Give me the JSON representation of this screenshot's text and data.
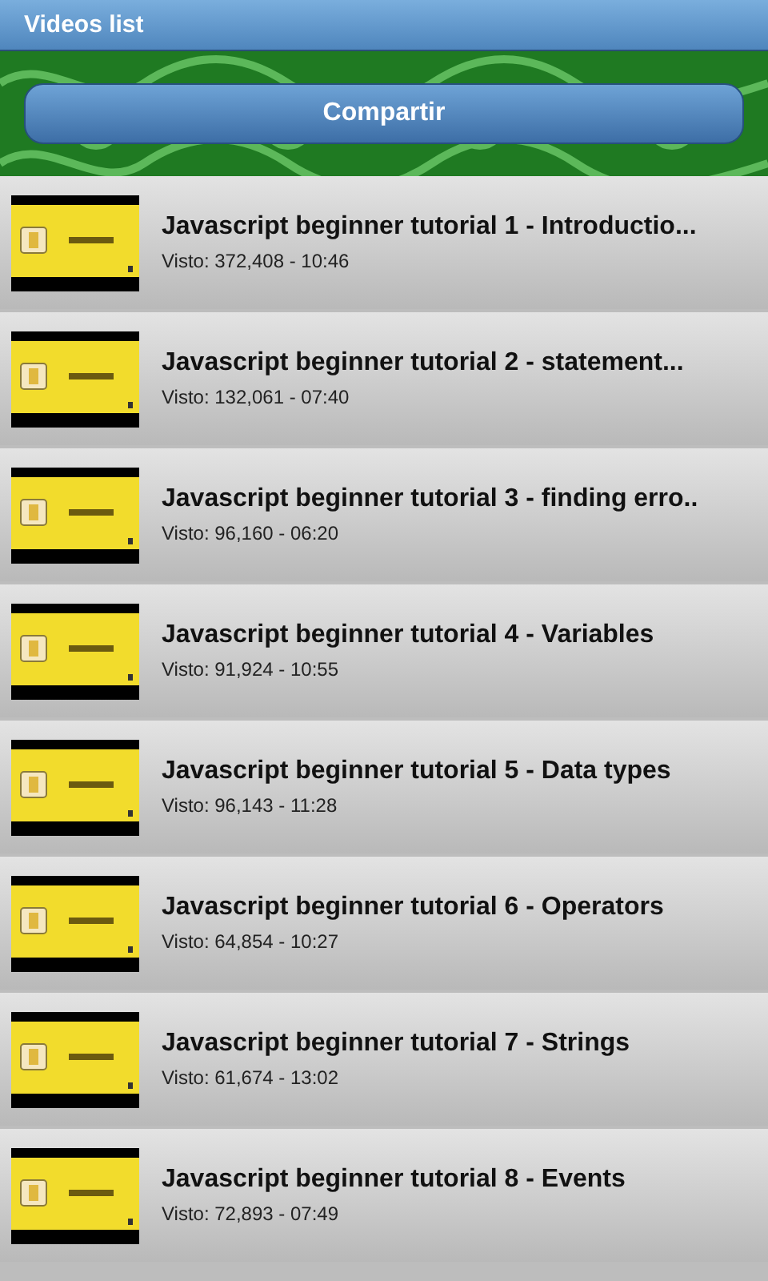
{
  "title_bar": {
    "title": "Videos list"
  },
  "share_button": {
    "label": "Compartir"
  },
  "videos": [
    {
      "title": "Javascript beginner tutorial 1 - Introductio...",
      "views": "Visto: 372,408 - 10:46"
    },
    {
      "title": "Javascript beginner tutorial 2 - statement...",
      "views": "Visto: 132,061 - 07:40"
    },
    {
      "title": "Javascript beginner tutorial 3 - finding erro..",
      "views": "Visto: 96,160 - 06:20"
    },
    {
      "title": "Javascript beginner tutorial 4 - Variables",
      "views": "Visto: 91,924 - 10:55"
    },
    {
      "title": "Javascript beginner tutorial 5 - Data types",
      "views": "Visto: 96,143 - 11:28"
    },
    {
      "title": "Javascript beginner tutorial 6 - Operators",
      "views": "Visto: 64,854 - 10:27"
    },
    {
      "title": "Javascript beginner tutorial 7 - Strings",
      "views": "Visto: 61,674 - 13:02"
    },
    {
      "title": "Javascript beginner tutorial 8 - Events",
      "views": "Visto: 72,893 - 07:49"
    }
  ]
}
